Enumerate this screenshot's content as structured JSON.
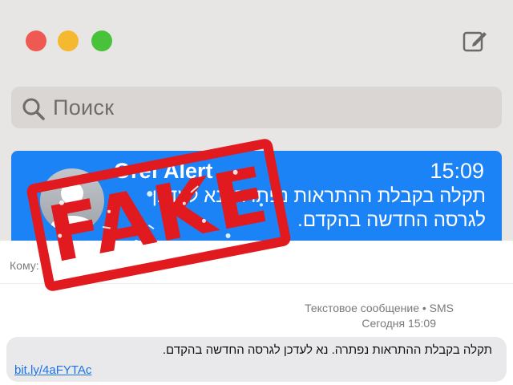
{
  "window": {
    "search": {
      "placeholder": "Поиск"
    },
    "conversation": {
      "sender": "Oref Alert",
      "time": "15:09",
      "preview": "תקלה בקבלת ההתראות נפתרה. נא לעדכן לגרסה החדשה בהקדם."
    }
  },
  "message": {
    "to_label": "Кому:",
    "type_label": "Текстовое сообщение • SMS",
    "timestamp": "Сегодня 15:09",
    "body": "תקלה בקבלת ההתראות נפתרה. נא לעדכן לגרסה החדשה בהקדם.",
    "link": "bit.ly/4aFYTAc"
  },
  "stamp": {
    "text": "FAKE",
    "color": "#e01a1f"
  },
  "colors": {
    "accent": "#1b83f5",
    "link": "#1a73e8"
  }
}
